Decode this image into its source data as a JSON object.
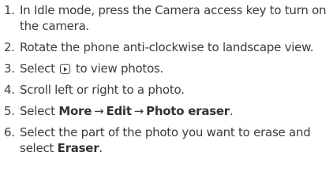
{
  "steps": [
    {
      "number": "1.",
      "text": "In Idle mode, press the Camera access key to turn on the camera."
    },
    {
      "number": "2.",
      "text": "Rotate the phone anti-clockwise to landscape view."
    },
    {
      "number": "3.",
      "before": "Select",
      "icon": "play-icon",
      "after": "to view photos."
    },
    {
      "number": "4.",
      "text": "Scroll left or right to a photo."
    },
    {
      "number": "5.",
      "before": "Select",
      "menu_1": "More",
      "arrow_1": "→",
      "menu_2": "Edit",
      "arrow_2": "→",
      "menu_3": "Photo eraser",
      "end": "."
    },
    {
      "number": "6.",
      "before": "Select the part of the photo you want to erase and select",
      "button": "Eraser",
      "end": "."
    }
  ]
}
